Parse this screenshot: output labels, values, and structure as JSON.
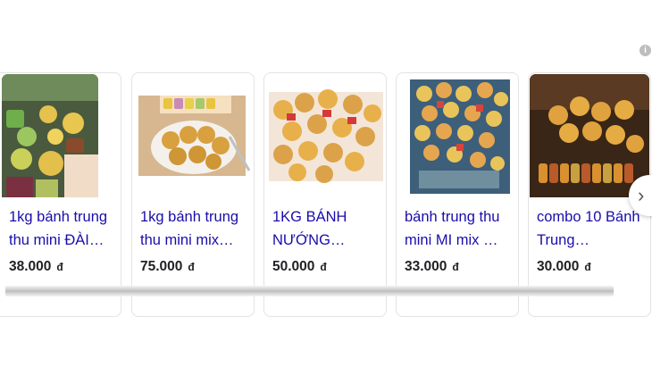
{
  "info_icon": "i",
  "products": [
    {
      "title": "1kg bánh trung thu mini ĐÀI…",
      "price": "38.000",
      "currency": "đ"
    },
    {
      "title": "1kg bánh trung thu mini mix…",
      "price": "75.000",
      "currency": "đ"
    },
    {
      "title": "1KG BÁNH NƯỚNG…",
      "price": "50.000",
      "currency": "đ"
    },
    {
      "title": "bánh trung thu mini MI mix …",
      "price": "33.000",
      "currency": "đ"
    },
    {
      "title": "combo 10 Bánh Trung…",
      "price": "30.000",
      "currency": "đ"
    }
  ],
  "next_button": "›"
}
